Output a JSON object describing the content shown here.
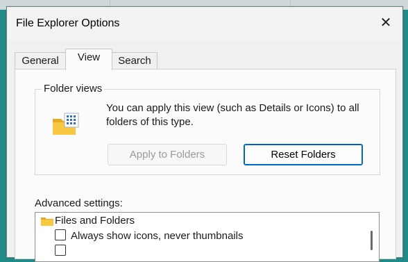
{
  "window": {
    "title": "File Explorer Options",
    "close_glyph": "✕"
  },
  "tabs": [
    {
      "label": "General"
    },
    {
      "label": "View"
    },
    {
      "label": "Search"
    }
  ],
  "folder_views": {
    "group_label": "Folder views",
    "description": "You can apply this view (such as Details or Icons) to all folders of this type.",
    "apply_button": "Apply to Folders",
    "reset_button": "Reset Folders",
    "icon": "folder-views-icon"
  },
  "advanced": {
    "label": "Advanced settings:",
    "items": [
      {
        "type": "folder",
        "label": "Files and Folders",
        "icon": "folder-icon"
      },
      {
        "type": "checkbox",
        "label": "Always show icons, never thumbnails",
        "checked": false
      }
    ]
  },
  "colors": {
    "desktop": "#1f8a86",
    "accent": "#0067c0",
    "folder_yellow": "#f8c842"
  }
}
